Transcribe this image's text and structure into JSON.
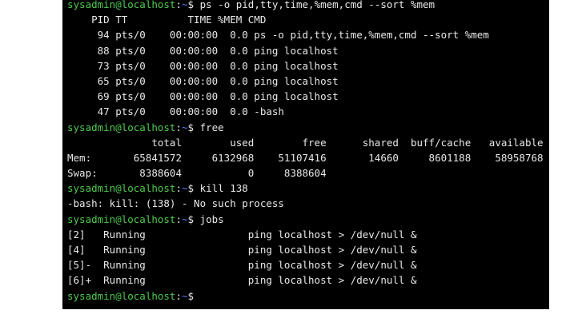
{
  "terminal": {
    "prompt_user_host": "sysadmin@localhost",
    "prompt_colon": ":",
    "prompt_path": "~",
    "prompt_dollar": "$",
    "colors": {
      "background": "#000000",
      "text": "#e8e8e8",
      "prompt": "#4ec94e",
      "path": "#5c7cff"
    },
    "lines": [
      {
        "type": "prompt",
        "command": " ps -o pid,tty,time,%mem,cmd --sort %mem"
      },
      {
        "type": "output",
        "text": "    PID TT          TIME %MEM CMD"
      },
      {
        "type": "output",
        "text": "     94 pts/0    00:00:00  0.0 ps -o pid,tty,time,%mem,cmd --sort %mem"
      },
      {
        "type": "output",
        "text": "     88 pts/0    00:00:00  0.0 ping localhost"
      },
      {
        "type": "output",
        "text": "     73 pts/0    00:00:00  0.0 ping localhost"
      },
      {
        "type": "output",
        "text": "     65 pts/0    00:00:00  0.0 ping localhost"
      },
      {
        "type": "output",
        "text": "     69 pts/0    00:00:00  0.0 ping localhost"
      },
      {
        "type": "output",
        "text": "     47 pts/0    00:00:00  0.0 -bash"
      },
      {
        "type": "prompt",
        "command": " free"
      },
      {
        "type": "output",
        "text": "              total        used        free      shared  buff/cache   available"
      },
      {
        "type": "output",
        "text": "Mem:       65841572     6132968    51107416       14660     8601188    58958768"
      },
      {
        "type": "output",
        "text": "Swap:       8388604           0     8388604"
      },
      {
        "type": "prompt",
        "command": " kill 138"
      },
      {
        "type": "output",
        "text": "-bash: kill: (138) - No such process"
      },
      {
        "type": "prompt",
        "command": " jobs"
      },
      {
        "type": "output",
        "text": "[2]   Running                 ping localhost > /dev/null &"
      },
      {
        "type": "output",
        "text": "[4]   Running                 ping localhost > /dev/null &"
      },
      {
        "type": "output",
        "text": "[5]-  Running                 ping localhost > /dev/null &"
      },
      {
        "type": "output",
        "text": "[6]+  Running                 ping localhost > /dev/null &"
      },
      {
        "type": "prompt",
        "command": ""
      }
    ]
  }
}
